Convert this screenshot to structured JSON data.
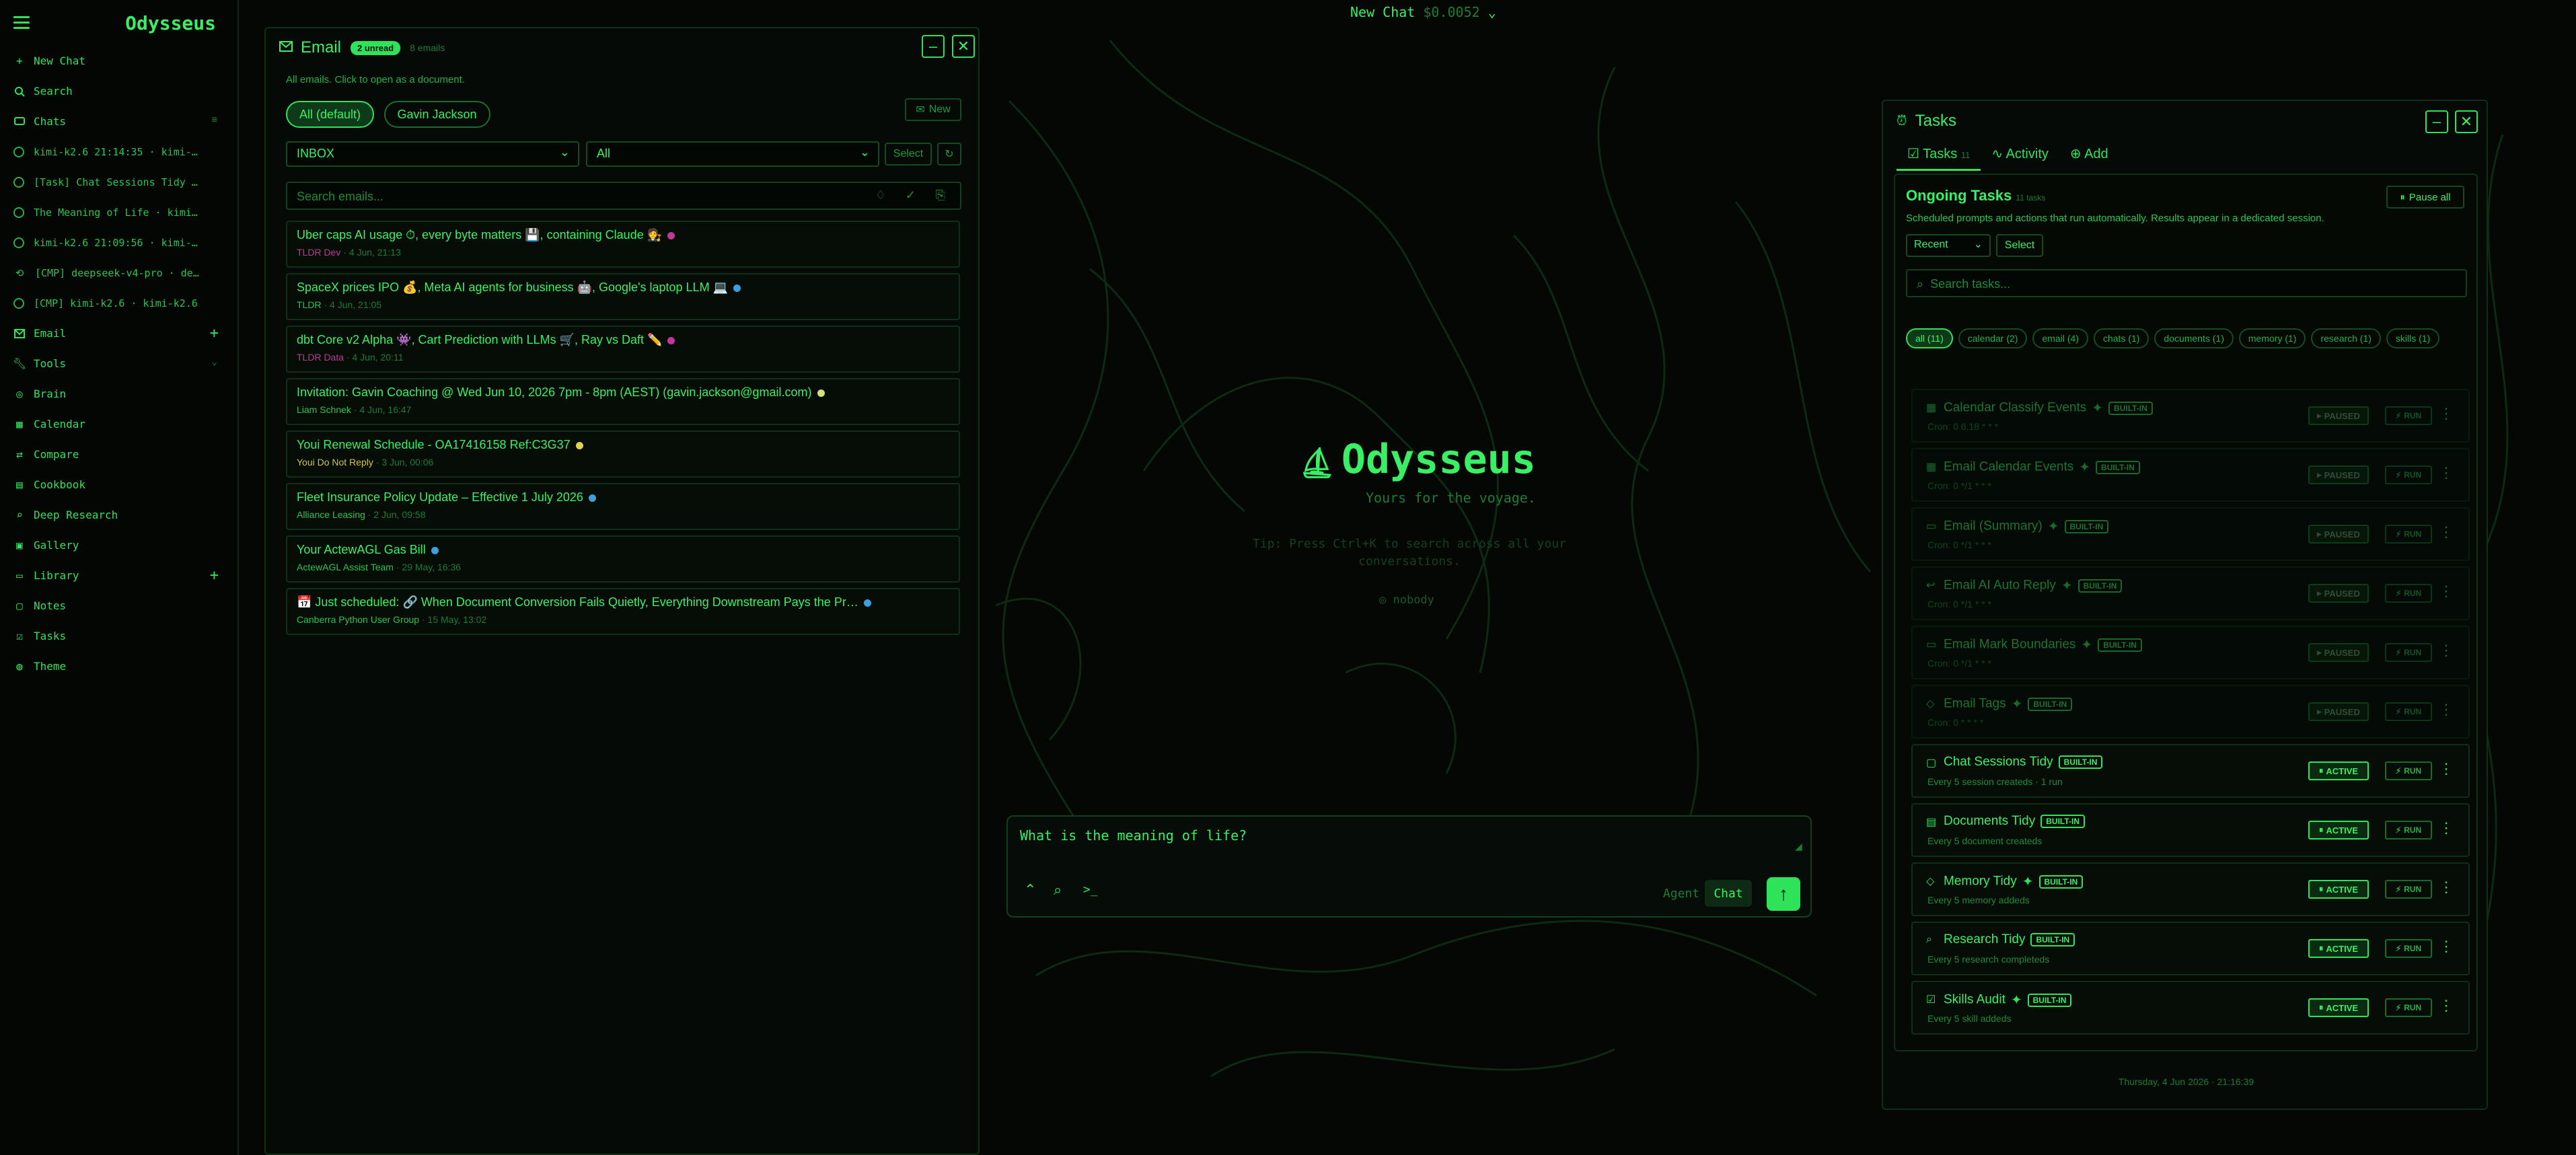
{
  "sidebar": {
    "brand": "Odysseus",
    "new_chat": "New Chat",
    "search": "Search",
    "chats": "Chats",
    "chat_items": [
      "kimi-k2.6 21:14:35 · kimi-…",
      "[Task] Chat Sessions Tidy …",
      "The Meaning of Life · kimi…",
      "kimi-k2.6 21:09:56 · kimi-…",
      "[CMP] deepseek-v4-pro · de…",
      "[CMP] kimi-k2.6 · kimi-k2.6"
    ],
    "email": "Email",
    "tools": "Tools",
    "tool_items": [
      "Brain",
      "Calendar",
      "Compare",
      "Cookbook",
      "Deep Research",
      "Gallery"
    ],
    "library": "Library",
    "library_items": [
      "Notes",
      "Tasks",
      "Theme"
    ]
  },
  "email": {
    "title": "Email",
    "unread": "2 unread",
    "count": "8 emails",
    "subtitle": "All emails. Click to open as a document.",
    "filter_all": "All (default)",
    "filter_person": "Gavin Jackson",
    "new_label": "New",
    "folder": "INBOX",
    "status_filter": "All",
    "select_label": "Select",
    "search_placeholder": "Search emails...",
    "rows": [
      {
        "subject": "Uber caps AI usage ⏱, every byte matters 💾, containing Claude 🧑‍⚖️",
        "from": "TLDR Dev",
        "date": "4 Jun, 21:13"
      },
      {
        "subject": "SpaceX prices IPO 💰, Meta AI agents for business 🤖, Google's laptop LLM 💻",
        "from": "TLDR",
        "date": "4 Jun, 21:05"
      },
      {
        "subject": "dbt Core v2 Alpha 👾, Cart Prediction with LLMs 🛒, Ray vs Daft ✏️",
        "from": "TLDR Data",
        "date": "4 Jun, 20:11"
      },
      {
        "subject": "Invitation: Gavin Coaching @ Wed Jun 10, 2026 7pm - 8pm (AEST) (gavin.jackson@gmail.com)",
        "from": "Liam Schnek",
        "date": "4 Jun, 16:47"
      },
      {
        "subject": "Youi Renewal Schedule - OA17416158 Ref:C3G37",
        "from": "Youi Do Not Reply",
        "date": "3 Jun, 00:06"
      },
      {
        "subject": "Fleet Insurance Policy Update – Effective 1 July 2026",
        "from": "Alliance Leasing",
        "date": "2 Jun, 09:58"
      },
      {
        "subject": "Your ActewAGL Gas Bill",
        "from": "ActewAGL Assist Team",
        "date": "29 May, 16:36"
      },
      {
        "subject": "📅 Just scheduled: 🔗 When Document Conversion Fails Quietly, Everything Downstream Pays the Pr…",
        "from": "Canberra Python User Group",
        "date": "15 May, 13:02"
      }
    ]
  },
  "center": {
    "top_label": "New Chat",
    "cost": "$0.0052",
    "logo": "Odysseus",
    "tagline": "Yours for the voyage.",
    "hint": "Tip: Press Ctrl+K to search across all your conversations.",
    "nobody": "nobody",
    "input_value": "What is the meaning of life?",
    "mode_agent": "Agent",
    "mode_chat": "Chat"
  },
  "tasks": {
    "title": "Tasks",
    "tab_tasks": "Tasks",
    "tab_tasks_count": "11",
    "tab_activity": "Activity",
    "tab_add": "Add",
    "section_title": "Ongoing Tasks",
    "section_count": "11 tasks",
    "pause_all": "Pause all",
    "description": "Scheduled prompts and actions that run automatically. Results appear in a dedicated session.",
    "sort": "Recent",
    "select": "Select",
    "search_placeholder": "Search tasks...",
    "chips": [
      "all (11)",
      "calendar (2)",
      "email (4)",
      "chats (1)",
      "documents (1)",
      "memory (1)",
      "research (1)",
      "skills (1)"
    ],
    "builtin": "BUILT-IN",
    "run": "RUN",
    "items": [
      {
        "name": "Calendar Classify Events",
        "desc": "Cron: 0 6,18 * * *",
        "status": "PAUSED",
        "star": true
      },
      {
        "name": "Email Calendar Events",
        "desc": "Cron: 0 */1 * * *",
        "status": "PAUSED",
        "star": true
      },
      {
        "name": "Email (Summary)",
        "desc": "Cron: 0 */1 * * *",
        "status": "PAUSED",
        "star": true
      },
      {
        "name": "Email AI Auto Reply",
        "desc": "Cron: 0 */1 * * *",
        "status": "PAUSED",
        "star": true
      },
      {
        "name": "Email Mark Boundaries",
        "desc": "Cron: 0 */1 * * *",
        "status": "PAUSED",
        "star": true
      },
      {
        "name": "Email Tags",
        "desc": "Cron: 0 * * * *",
        "status": "PAUSED",
        "star": true
      },
      {
        "name": "Chat Sessions Tidy",
        "desc": "Every 5 session createds · 1 run",
        "status": "ACTIVE",
        "star": false
      },
      {
        "name": "Documents Tidy",
        "desc": "Every 5 document createds",
        "status": "ACTIVE",
        "star": false
      },
      {
        "name": "Memory Tidy",
        "desc": "Every 5 memory addeds",
        "status": "ACTIVE",
        "star": true
      },
      {
        "name": "Research Tidy",
        "desc": "Every 5 research completeds",
        "status": "ACTIVE",
        "star": false
      },
      {
        "name": "Skills Audit",
        "desc": "Every 5 skill addeds",
        "status": "ACTIVE",
        "star": true
      }
    ],
    "footer": "Thursday, 4 Jun 2026 · 21:16:39"
  },
  "colors": {
    "accent": "#2ee35a",
    "background": "#040704",
    "muted": "#1f7a35"
  }
}
